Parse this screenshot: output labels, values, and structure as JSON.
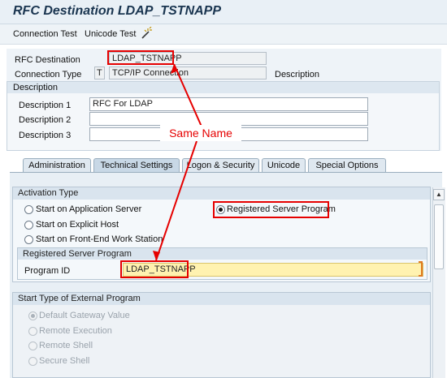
{
  "title": "RFC Destination LDAP_TSTNAPP",
  "toolbar": {
    "connection_test": "Connection Test",
    "unicode_test": "Unicode Test"
  },
  "header": {
    "rfc_destination_label": "RFC Destination",
    "rfc_destination_value": "LDAP_TSTNAPP",
    "connection_type_label": "Connection Type",
    "connection_type_code": "T",
    "connection_type_value": "TCP/IP Connection",
    "connection_type_desc": "Description"
  },
  "description": {
    "section_title": "Description",
    "d1_label": "Description 1",
    "d1_value": "RFC For LDAP",
    "d2_label": "Description 2",
    "d2_value": "",
    "d3_label": "Description 3",
    "d3_value": ""
  },
  "tabs": [
    "Administration",
    "Technical Settings",
    "Logon & Security",
    "Unicode",
    "Special Options"
  ],
  "activation": {
    "title": "Activation Type",
    "opt_app_server": "Start on Application Server",
    "opt_explicit_host": "Start on Explicit Host",
    "opt_frontend": "Start on Front-End Work Station",
    "opt_registered": "Registered Server Program",
    "selected": "Registered Server Program"
  },
  "registered": {
    "title": "Registered Server Program",
    "program_id_label": "Program ID",
    "program_id_value": "LDAP_TSTNAPP"
  },
  "start_type": {
    "title": "Start Type of External Program",
    "opt_gateway": "Default Gateway Value",
    "opt_remote_exec": "Remote Execution",
    "opt_remote_shell": "Remote Shell",
    "opt_secure_shell": "Secure Shell",
    "selected": "Default Gateway Value"
  },
  "annotation": {
    "label": "Same Name",
    "color": "#e60000"
  },
  "icons": {
    "toolbar_wand": "wand-icon",
    "scroll_up": "scroll-up-icon",
    "scroll_down": "scroll-down-icon"
  },
  "colors": {
    "title": "#1a3550",
    "highlight_field": "#fff2b0"
  }
}
